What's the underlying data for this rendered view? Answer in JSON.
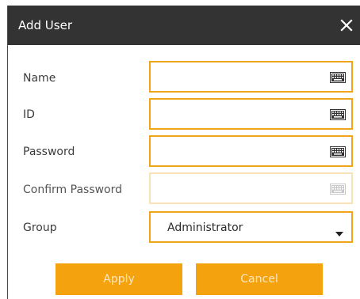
{
  "dialog": {
    "title": "Add User",
    "close_icon": "close-icon"
  },
  "form": {
    "name_label": "Name",
    "name_value": "",
    "id_label": "ID",
    "id_value": "",
    "password_label": "Password",
    "password_value": "",
    "confirm_password_label": "Confirm Password",
    "confirm_password_value": "",
    "group_label": "Group",
    "group_value": "Administrator",
    "keyboard_icon": "keyboard-icon",
    "dropdown_icon": "chevron-down-icon"
  },
  "buttons": {
    "apply": "Apply",
    "cancel": "Cancel"
  },
  "colors": {
    "accent": "#f5a20f",
    "field_border": "#f2a51b",
    "field_border_disabled": "#f9e2b5",
    "titlebar": "#333333",
    "button_text": "#fce6c1"
  }
}
